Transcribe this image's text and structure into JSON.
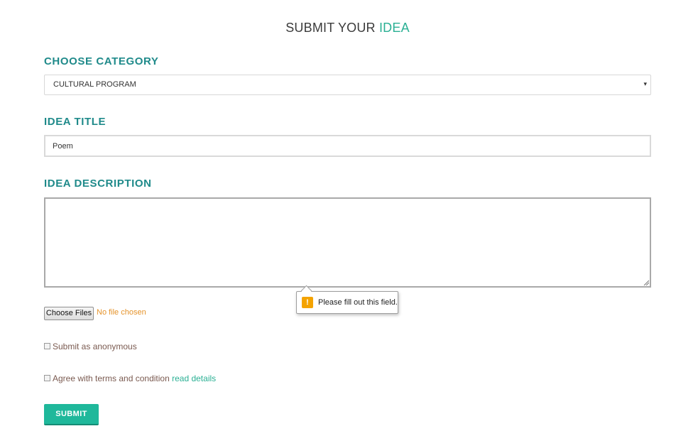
{
  "title": {
    "prefix": "SUBMIT YOUR",
    "accent": "IDEA"
  },
  "category": {
    "label": "CHOOSE CATEGORY",
    "selected": "CULTURAL PROGRAM",
    "caret": "▾"
  },
  "idea_title": {
    "label": "IDEA TITLE",
    "value": "Poem"
  },
  "idea_description": {
    "label": "IDEA DESCRIPTION",
    "value": ""
  },
  "validation_tooltip": {
    "icon": "warning-icon",
    "icon_glyph": "!",
    "message": "Please fill out this field."
  },
  "file_upload": {
    "button_label": "Choose Files",
    "status": "No file chosen"
  },
  "anonymous": {
    "label": "Submit as anonymous",
    "checked": false
  },
  "terms": {
    "label": "Agree with terms and condition",
    "link": "read details",
    "checked": false
  },
  "submit": {
    "label": "SUBMIT"
  },
  "colors": {
    "accent": "#2bb094",
    "section_label": "#1f8a8a",
    "button": "#1fb89b",
    "warning": "#f4a300",
    "file_status": "#e5932b"
  }
}
